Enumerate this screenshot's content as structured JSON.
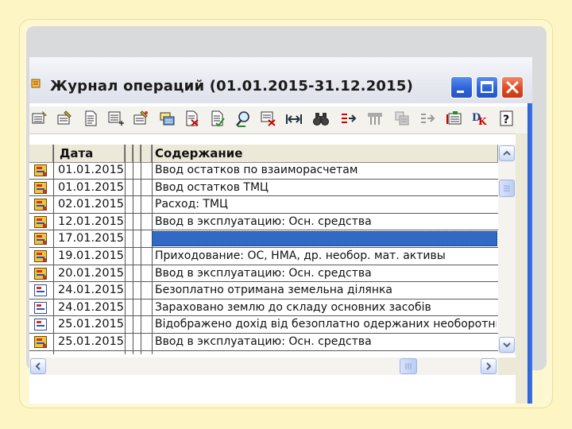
{
  "window": {
    "title": "Журнал операций (01.01.2015-31.12.2015)",
    "buttons": [
      "minimize",
      "maximize",
      "close"
    ]
  },
  "toolbar": {
    "icons": [
      "new-record-icon",
      "edit-icon",
      "document-icon",
      "add-list-icon",
      "copy-edit-icon",
      "print-icon",
      "delete-icon",
      "post-document-icon",
      "search-icon",
      "filter-icon",
      "interval-icon",
      "binoculars-icon",
      "move-right-icon",
      "grid-icon",
      "structure-icon",
      "tree-icon",
      "journal-icon",
      "dt-kt-icon",
      "help-icon"
    ]
  },
  "table": {
    "columns": [
      "Дата",
      "Содержание"
    ],
    "rows": [
      {
        "date": "01.01.2015",
        "text": "Ввод остатков по взаиморасчетам",
        "icon": "yellow-doc-icon",
        "selected": false
      },
      {
        "date": "01.01.2015",
        "text": "Ввод остатков ТМЦ",
        "icon": "yellow-doc-icon",
        "selected": false
      },
      {
        "date": "02.01.2015",
        "text": "Расход: ТМЦ",
        "icon": "yellow-doc-icon",
        "selected": false
      },
      {
        "date": "12.01.2015",
        "text": "Ввод в эксплуатацию: Осн. средства",
        "icon": "yellow-doc-icon",
        "selected": false
      },
      {
        "date": "17.01.2015",
        "text": "",
        "icon": "yellow-doc-icon",
        "selected": true
      },
      {
        "date": "19.01.2015",
        "text": "Приходование: ОС, НМА, др. необор. мат. активы",
        "icon": "yellow-doc-icon",
        "selected": false
      },
      {
        "date": "20.01.2015",
        "text": "Ввод в эксплуатацию: Осн. средства",
        "icon": "yellow-doc-icon",
        "selected": false
      },
      {
        "date": "24.01.2015",
        "text": "Безоплатно отримана земельна ділянка",
        "icon": "white-doc-icon",
        "selected": false
      },
      {
        "date": "24.01.2015",
        "text": "Зараховано землю до складу основних засобів",
        "icon": "white-doc-icon",
        "selected": false
      },
      {
        "date": "25.01.2015",
        "text": "Відображено дохід від безоплатно одержаних необоротних",
        "icon": "white-doc-icon",
        "selected": false
      },
      {
        "date": "25.01.2015",
        "text": "Ввод в эксплуатацию: Осн. средства",
        "icon": "yellow-doc-icon",
        "selected": false
      }
    ]
  },
  "colors": {
    "slide_bg": "#fdf6c4",
    "selection": "#316ac5",
    "titlebar_button_blue": "#2d62d8",
    "titlebar_button_red": "#dc4a26"
  }
}
